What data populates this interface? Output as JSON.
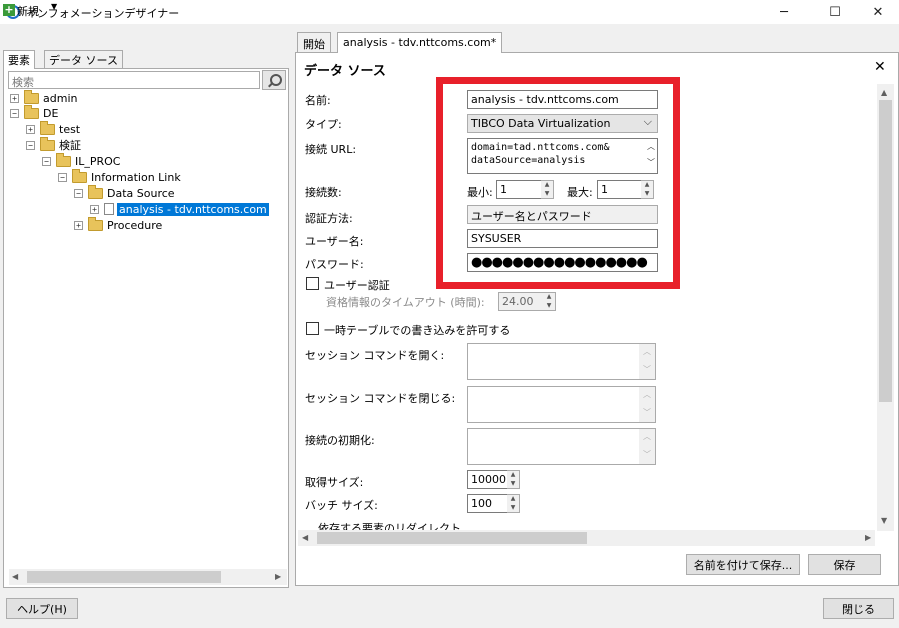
{
  "window": {
    "title": "インフォメーションデザイナー",
    "min": "─",
    "max": "☐",
    "close": "✕"
  },
  "left": {
    "new_label": "新規",
    "new_arrow": "▼",
    "tabs": [
      "要素",
      "データ ソース"
    ],
    "search_placeholder": "検索",
    "tree": [
      {
        "label": "admin",
        "exp": "+"
      },
      {
        "label": "DE",
        "exp": "−"
      },
      {
        "label": "test",
        "exp": "+"
      },
      {
        "label": "検証",
        "exp": "−"
      },
      {
        "label": "IL_PROC",
        "exp": "−"
      },
      {
        "label": "Information Link",
        "exp": "−"
      },
      {
        "label": "Data Source",
        "exp": "−"
      },
      {
        "label": "analysis - tdv.nttcoms.com",
        "exp": "+"
      },
      {
        "label": "Procedure",
        "exp": "+"
      }
    ]
  },
  "right": {
    "tabs": [
      "開始",
      "analysis - tdv.nttcoms.com*"
    ],
    "panel_title": "データ ソース",
    "close": "✕",
    "fields": {
      "name_label": "名前:",
      "name_value": "analysis - tdv.nttcoms.com",
      "type_label": "タイプ:",
      "type_value": "TIBCO Data Virtualization",
      "url_label": "接続 URL:",
      "url_line1": "domain=tad.nttcoms.com&",
      "url_line2": "dataSource=analysis",
      "conn_label": "接続数:",
      "min_label": "最小:",
      "min_value": "1",
      "max_label": "最大:",
      "max_value": "1",
      "auth_label": "認証方法:",
      "auth_value": "ユーザー名とパスワード",
      "user_label": "ユーザー名:",
      "user_value": "SYSUSER",
      "pass_label": "パスワード:",
      "pass_value": "●●●●●●●●●●●●●●●●●",
      "user_auth_label": "ユーザー認証",
      "timeout_label": "資格情報のタイムアウト (時間):",
      "timeout_value": "24.00",
      "temp_table_label": "一時テーブルでの書き込みを許可する",
      "open_cmd_label": "セッション コマンドを開く:",
      "close_cmd_label": "セッション コマンドを閉じる:",
      "init_label": "接続の初期化:",
      "fetch_label": "取得サイズ:",
      "fetch_value": "10000",
      "batch_label": "バッチ サイズ:",
      "batch_value": "100",
      "redirect_label": "依存する要素のリダイレクト"
    },
    "save_as": "名前を付けて保存...",
    "save": "保存"
  },
  "footer": {
    "help": "ヘルプ(H)",
    "close": "閉じる"
  }
}
